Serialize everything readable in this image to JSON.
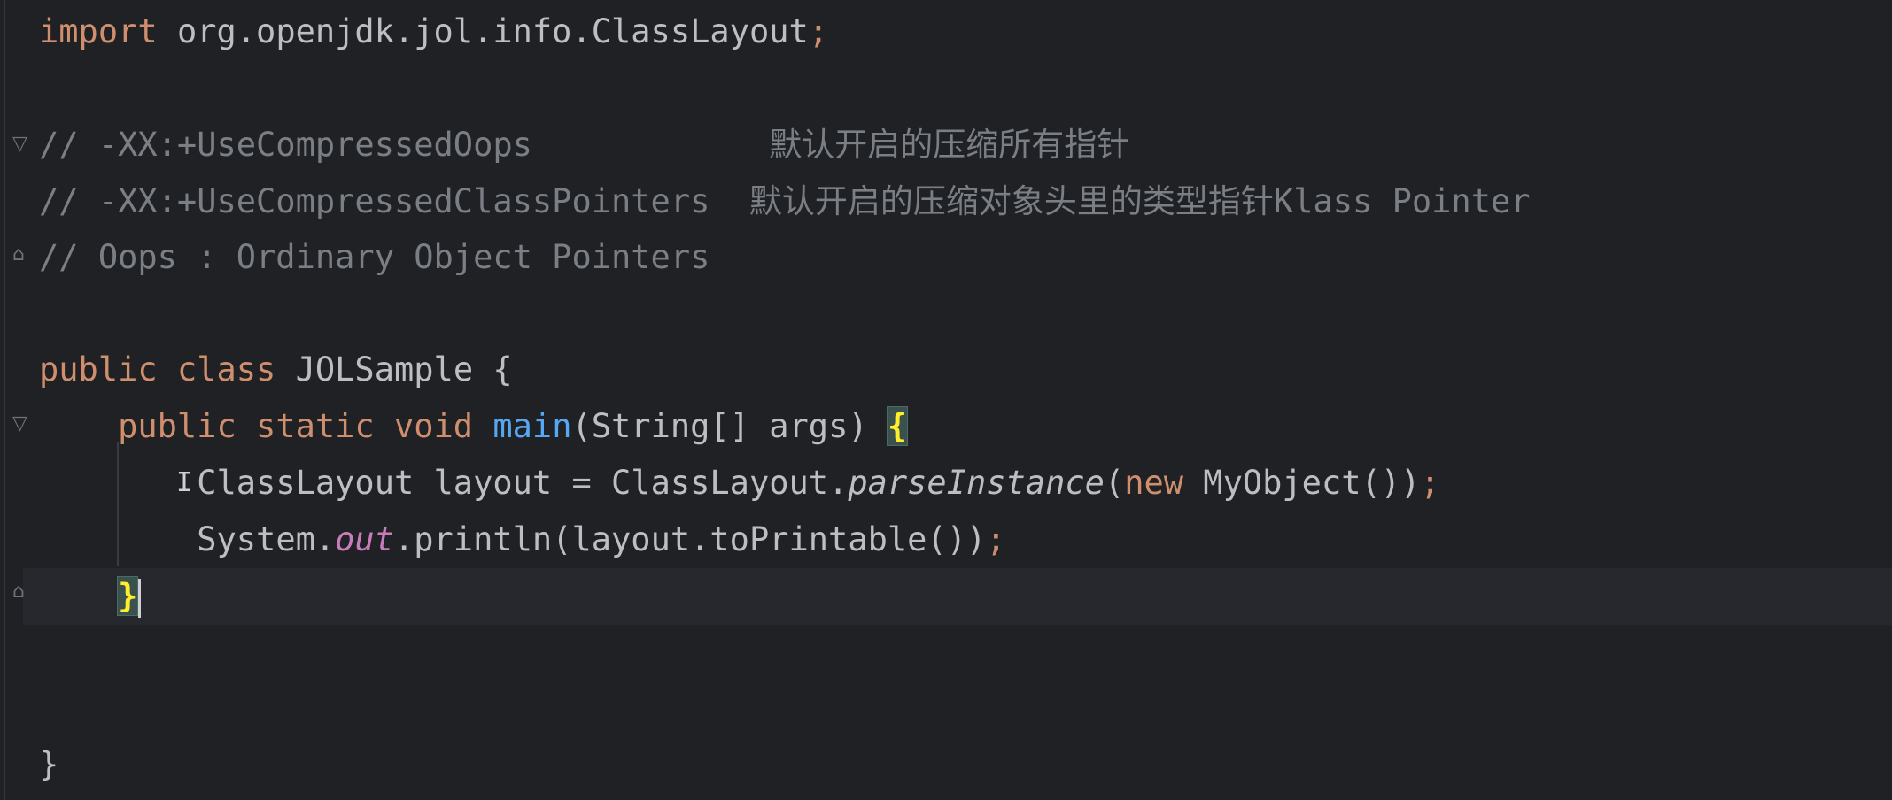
{
  "editor": {
    "lines": {
      "import_kw": "import",
      "import_path": "org.openjdk.jol.info.ClassLayout",
      "import_semi": ";",
      "comment1": "// -XX:+UseCompressedOops            默认开启的压缩所有指针",
      "comment2": "// -XX:+UseCompressedClassPointers  默认开启的压缩对象头里的类型指针Klass Pointer",
      "comment3": "// Oops : Ordinary Object Pointers",
      "class_kw1": "public",
      "class_kw2": "class",
      "class_name": "JOLSample",
      "class_brace": "{",
      "main_kw1": "public",
      "main_kw2": "static",
      "main_kw3": "void",
      "main_name": "main",
      "main_params": "(String[] args) ",
      "main_brace": "{",
      "l1_type": "ClassLayout layout = ClassLayout.",
      "l1_method": "parseInstance",
      "l1_open": "(",
      "l1_new": "new",
      "l1_rest": " MyObject())",
      "l1_semi": ";",
      "l2_start": "System.",
      "l2_field": "out",
      "l2_rest": ".println(layout.toPrintable())",
      "l2_semi": ";",
      "close_main": "}",
      "close_class": "}"
    }
  }
}
